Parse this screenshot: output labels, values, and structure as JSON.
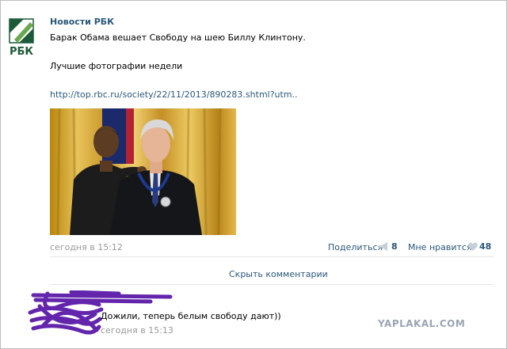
{
  "post": {
    "author": "Новости РБК",
    "logo_label": "РБК",
    "text": "Барак Обама вешает Свободу на шею Биллу Клинтону.",
    "subtext": "Лучшие фотографии недели",
    "link": "http://top.rbc.ru/society/22/11/2013/890283.shtml?utm..",
    "date": "сегодня в 15:12",
    "share_label": "Поделиться",
    "share_count": "8",
    "like_label": "Мне нравится",
    "like_count": "48",
    "hide_comments": "Скрыть комментарии"
  },
  "comment": {
    "text": "Дожили, теперь белым свободу дают))",
    "date": "сегодня в 15:13"
  },
  "watermark": "YAPLAKAL.COM",
  "colors": {
    "link": "#2b587a",
    "muted": "#999999",
    "scribble": "#5a1aa8",
    "logo_green": "#1d5a3a"
  },
  "icons": [
    "rbc-logo-icon",
    "megaphone-icon",
    "heart-icon",
    "scribble-overlay"
  ]
}
